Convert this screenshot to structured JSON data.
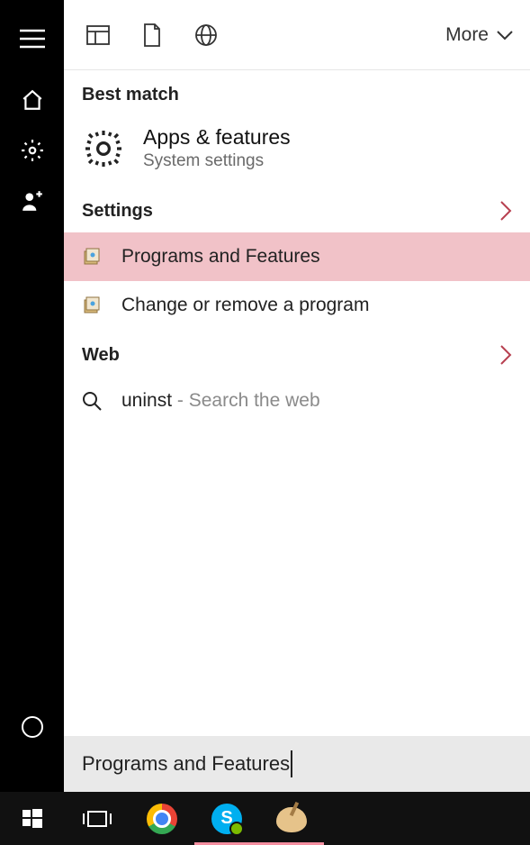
{
  "topbar": {
    "more_label": "More"
  },
  "sections": {
    "best_match": "Best match",
    "settings": "Settings",
    "web": "Web"
  },
  "best_match_item": {
    "title": "Apps & features",
    "subtitle": "System settings"
  },
  "settings_items": [
    {
      "label": "Programs and Features",
      "highlighted": true
    },
    {
      "label": "Change or remove a program",
      "highlighted": false
    }
  ],
  "web_item": {
    "query": "uninst",
    "suffix": " - Search the web"
  },
  "search_input": {
    "value": "Programs and Features"
  },
  "taskbar": {
    "items": [
      "start",
      "task-view",
      "chrome",
      "skype",
      "paint"
    ]
  }
}
